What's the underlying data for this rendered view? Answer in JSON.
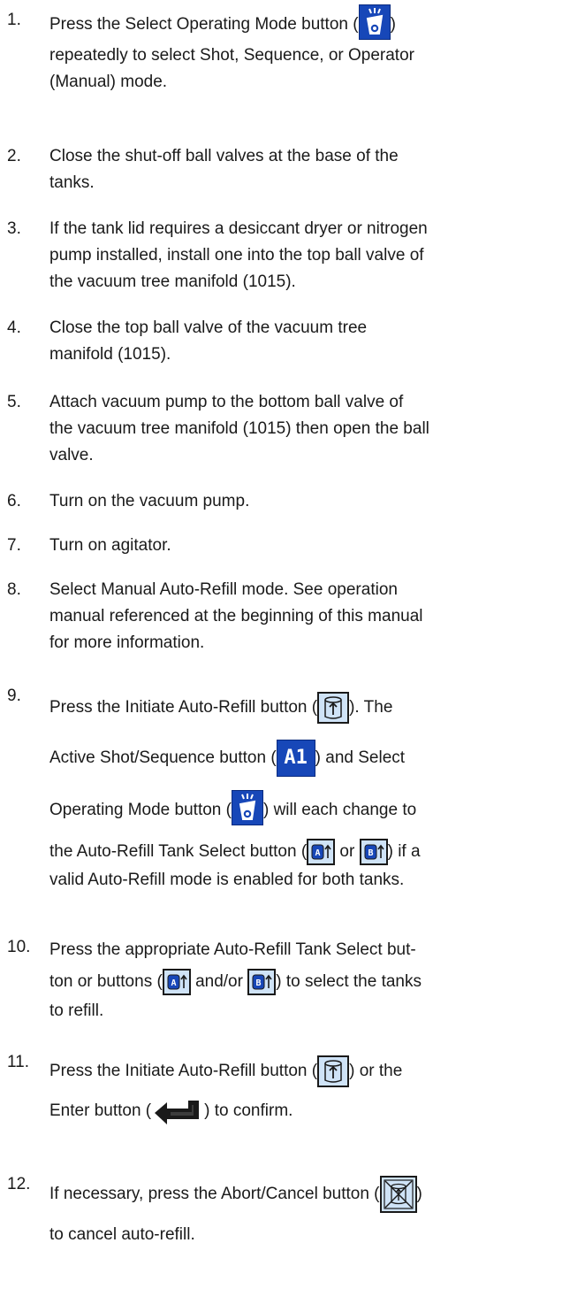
{
  "steps": [
    {
      "number": "1.",
      "lines": [
        "Press the Select Operating Mode button (",
        ")",
        "repeatedly to select Shot, Sequence, or Operator",
        "(Manual) mode."
      ]
    },
    {
      "number": "2.",
      "lines": [
        "Close the shut-off ball valves at the base of the",
        "tanks."
      ]
    },
    {
      "number": "3.",
      "lines": [
        "If the tank lid requires a desiccant dryer or nitrogen",
        "pump installed, install one into the top ball valve of",
        "the vacuum tree manifold (1015)."
      ]
    },
    {
      "number": "4.",
      "lines": [
        "Close the top ball valve of the vacuum tree",
        "manifold (1015)."
      ]
    },
    {
      "number": "5.",
      "lines": [
        "Attach vacuum pump to the bottom ball valve of",
        "the vacuum tree manifold (1015) then open the ball",
        "valve."
      ]
    },
    {
      "number": "6.",
      "lines": [
        "Turn on the vacuum pump."
      ]
    },
    {
      "number": "7.",
      "lines": [
        "Turn on agitator."
      ]
    },
    {
      "number": "8.",
      "lines": [
        "Select Manual Auto-Refill mode. See operation",
        "manual referenced at the beginning of this manual",
        "for more information."
      ]
    },
    {
      "number": "9.",
      "lines": [
        "Press the Initiate Auto-Refill button (",
        "). The",
        "Active Shot/Sequence button (",
        ") and Select",
        "Operating Mode button (",
        ") will each change to",
        "the Auto-Refill Tank Select button (",
        " or ",
        ") if a",
        "valid Auto-Refill mode is enabled for both tanks."
      ]
    },
    {
      "number": "10.",
      "lines": [
        "Press the appropriate Auto-Refill Tank Select but-",
        "ton or buttons (",
        " and/or ",
        ") to select the tanks",
        "to refill."
      ]
    },
    {
      "number": "11.",
      "lines": [
        "Press the Initiate Auto-Refill button (",
        ") or the",
        "Enter button (",
        ") to confirm."
      ]
    },
    {
      "number": "12.",
      "lines": [
        "If necessary, press the Abort/Cancel button (",
        ")",
        "to cancel auto-refill."
      ]
    }
  ],
  "icons": {
    "a1_label": "A1",
    "tank_a_letter": "A",
    "tank_b_letter": "B"
  },
  "colors": {
    "icon_blue": "#1747b8",
    "icon_light": "#cfe3f7"
  }
}
